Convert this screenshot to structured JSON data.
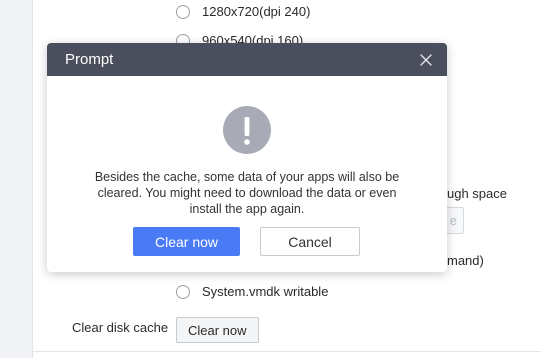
{
  "background": {
    "resolution_options": [
      {
        "label": "1280x720(dpi 240)"
      },
      {
        "label": "960x540(dpi 160)"
      }
    ],
    "partial_texts": {
      "disk_space": "ugh space",
      "partial_button": "e",
      "command": "mand)"
    },
    "system_vmdk_option": "System.vmdk writable",
    "clear_disk_cache_label": "Clear disk cache",
    "clear_disk_cache_button": "Clear now"
  },
  "dialog": {
    "title": "Prompt",
    "icon": "exclamation-icon",
    "message_lines": [
      "Besides the cache, some data of your apps will also be",
      "cleared. You might need to download the data or even",
      "install the app again."
    ],
    "primary_button": "Clear now",
    "secondary_button": "Cancel"
  },
  "colors": {
    "header": "#4b4f5d",
    "primary": "#4b7bf4",
    "icon_bg": "#a8abb5"
  }
}
